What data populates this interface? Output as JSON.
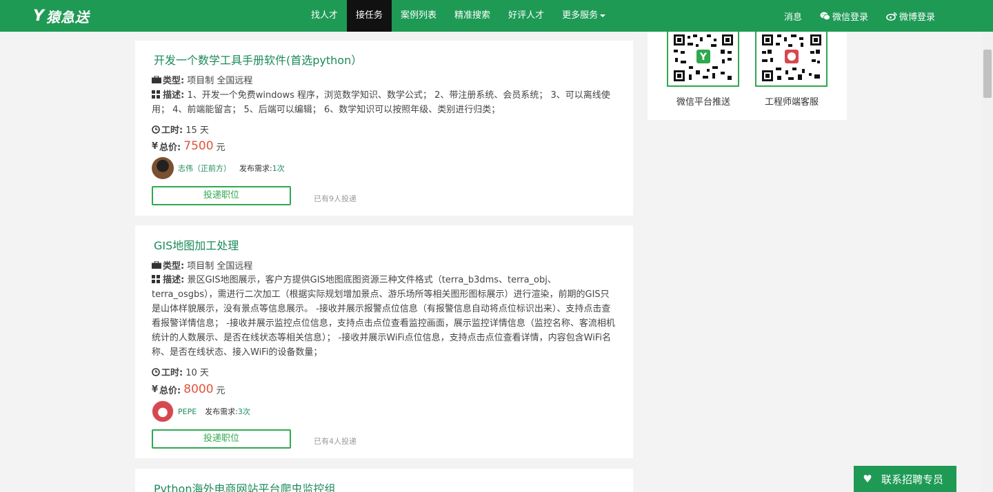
{
  "brand": {
    "name": "猿急送"
  },
  "nav": {
    "items": [
      "找人才",
      "接任务",
      "案例列表",
      "精准搜索",
      "好评人才",
      "更多服务"
    ],
    "active_index": 1
  },
  "nav_right": {
    "messages": "消息",
    "wechat_login": "微信登录",
    "weibo_login": "微博登录"
  },
  "sidebar": {
    "qr1_label": "微信平台推送",
    "qr2_label": "工程师端客服"
  },
  "jobs": [
    {
      "title": "开发一个数学工具手册软件(首选python）",
      "type_label": "类型:",
      "type_value": "项目制 全国远程",
      "desc_label": "描述:",
      "desc_value": "1、开发一个免费windows 程序，浏览数学知识、数学公式； 2、带注册系统、会员系统； 3、可以离线使用； 4、前端能留言； 5、后端可以编辑； 6、数学知识可以按照年级、类别进行归类；",
      "time_label": "工时:",
      "time_value": "15 天",
      "price_label": "总价:",
      "price_value": "7500",
      "price_unit": "元",
      "poster_name": "志伟（正前方）",
      "posted_label": "发布需求:",
      "posted_count": "1次",
      "apply_label": "投递职位",
      "applied_text": "已有9人投递"
    },
    {
      "title": "GIS地图加工处理",
      "type_label": "类型:",
      "type_value": "项目制 全国远程",
      "desc_label": "描述:",
      "desc_value": "景区GIS地图展示，客户方提供GIS地图底图资源三种文件格式（terra_b3dms、terra_obj、terra_osgbs），需进行二次加工（根据实际规划增加景点、游乐场所等相关图形图标展示）进行渲染，前期的GIS只是山体样貌展示，没有景点等信息展示。 -接收并展示报警点位信息（有报警信息自动将点位标识出来）、支持点击查看报警详情信息； -接收并展示监控点位信息，支持点击点位查看监控画面，展示监控详情信息（监控名称、客流相机统计的人数展示、是否在线状态等相关信息）； -接收并展示WiFi点位信息，支持点击点位查看详情，内容包含WiFi名称、是否在线状态、接入WiFi的设备数量；",
      "time_label": "工时:",
      "time_value": "10 天",
      "price_label": "总价:",
      "price_value": "8000",
      "price_unit": "元",
      "poster_name": "PEPE",
      "posted_label": "发布需求:",
      "posted_count": "3次",
      "apply_label": "投递职位",
      "applied_text": "已有4人投递"
    },
    {
      "title": "Python海外电商网站平台爬虫监控组"
    }
  ],
  "contact": {
    "label": "联系招聘专员"
  },
  "colors": {
    "brand_green": "#1e9a55",
    "link_green": "#1b8a5a",
    "price_red": "#e2533b",
    "nav_active": "#111111"
  }
}
